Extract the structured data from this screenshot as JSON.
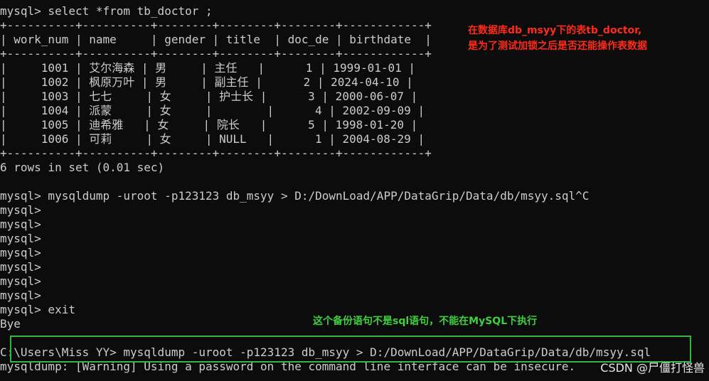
{
  "colors": {
    "background": "#0c0c0c",
    "foreground": "#cccccc",
    "annotation_red": "#ff2a1a",
    "annotation_green": "#3fcf3f",
    "highlight_box": "#35b544"
  },
  "terminal": {
    "lines": [
      "mysql> select *from tb_doctor ;",
      "+----------+----------+--------+--------+--------+------------+",
      "| work_num | name     | gender | title  | doc_de | birthdate  |",
      "+----------+----------+--------+--------+--------+------------+",
      "|     1001 | 艾尔海森 | 男     | 主任   |      1 | 1999-01-01 |",
      "|     1002 | 枫原万叶 | 男     | 副主任 |      2 | 2024-04-10 |",
      "|     1003 | 七七     | 女     | 护士长 |      3 | 2000-06-07 |",
      "|     1004 | 派蒙     | 女     |        |      4 | 2002-09-09 |",
      "|     1005 | 迪希雅   | 女     | 院长   |      5 | 1998-01-20 |",
      "|     1006 | 可莉     | 女     | NULL   |      1 | 2004-08-29 |",
      "+----------+----------+--------+--------+--------+------------+",
      "6 rows in set (0.01 sec)",
      "",
      "mysql> mysqldump -uroot -p123123 db_msyy > D:/DownLoad/APP/DataGrip/Data/db/msyy.sql^C",
      "mysql>",
      "mysql>",
      "mysql>",
      "mysql>",
      "mysql>",
      "mysql>",
      "mysql>",
      "mysql> exit",
      "Bye",
      "",
      "C:\\Users\\Miss YY> mysqldump -uroot -p123123 db_msyy > D:/DownLoad/APP/DataGrip/Data/db/msyy.sql",
      "mysqldump: [Warning] Using a password on the command line interface can be insecure."
    ]
  },
  "annotations": {
    "red_line1": "在数据库db_msyy下的表tb_doctor,",
    "red_line2": "是为了测试加锁之后是否还能操作表数据",
    "green": "这个备份语句不是sql语句，不能在MySQL下执行"
  },
  "watermark": "CSDN @尸僵打怪兽"
}
